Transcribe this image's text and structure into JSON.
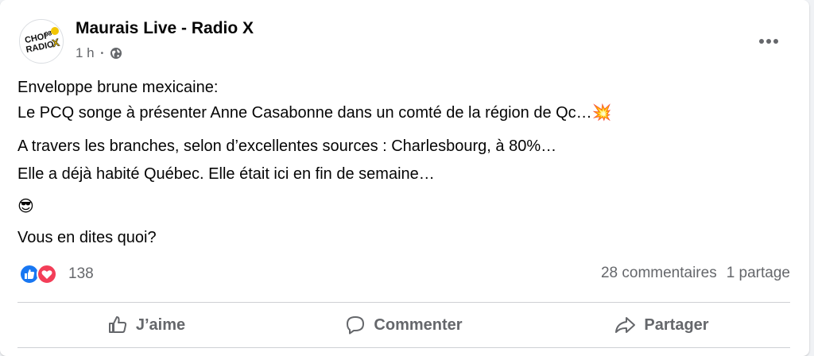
{
  "header": {
    "page_name": "Maurais Live - Radio X",
    "time": "1 h",
    "avatar_icon": "choi-radio-x-logo",
    "privacy_icon": "globe-icon",
    "more_icon": "more-options-icon"
  },
  "post": {
    "line1": "Enveloppe brune mexicaine:",
    "line2": "Le PCQ songe à présenter Anne Casabonne dans un comté de la région de Qc…",
    "line2_emoji": "💥",
    "line3": "A travers les branches, selon d’excellentes sources : Charlesbourg, à 80%…",
    "line4": "Elle a déjà habité Québec. Elle était ici en fin de semaine…",
    "line5_emoji": "😎",
    "line6": "Vous en dites quoi?"
  },
  "reactions": {
    "count": "138",
    "icons": [
      "like-reaction-icon",
      "love-reaction-icon"
    ]
  },
  "stats": {
    "comments": "28 commentaires",
    "shares": "1 partage"
  },
  "actions": {
    "like": "J’aime",
    "comment": "Commenter",
    "share": "Partager"
  },
  "colors": {
    "like_blue": "#1877f2",
    "love_red": "#f33e58",
    "secondary_text": "#65676b"
  }
}
